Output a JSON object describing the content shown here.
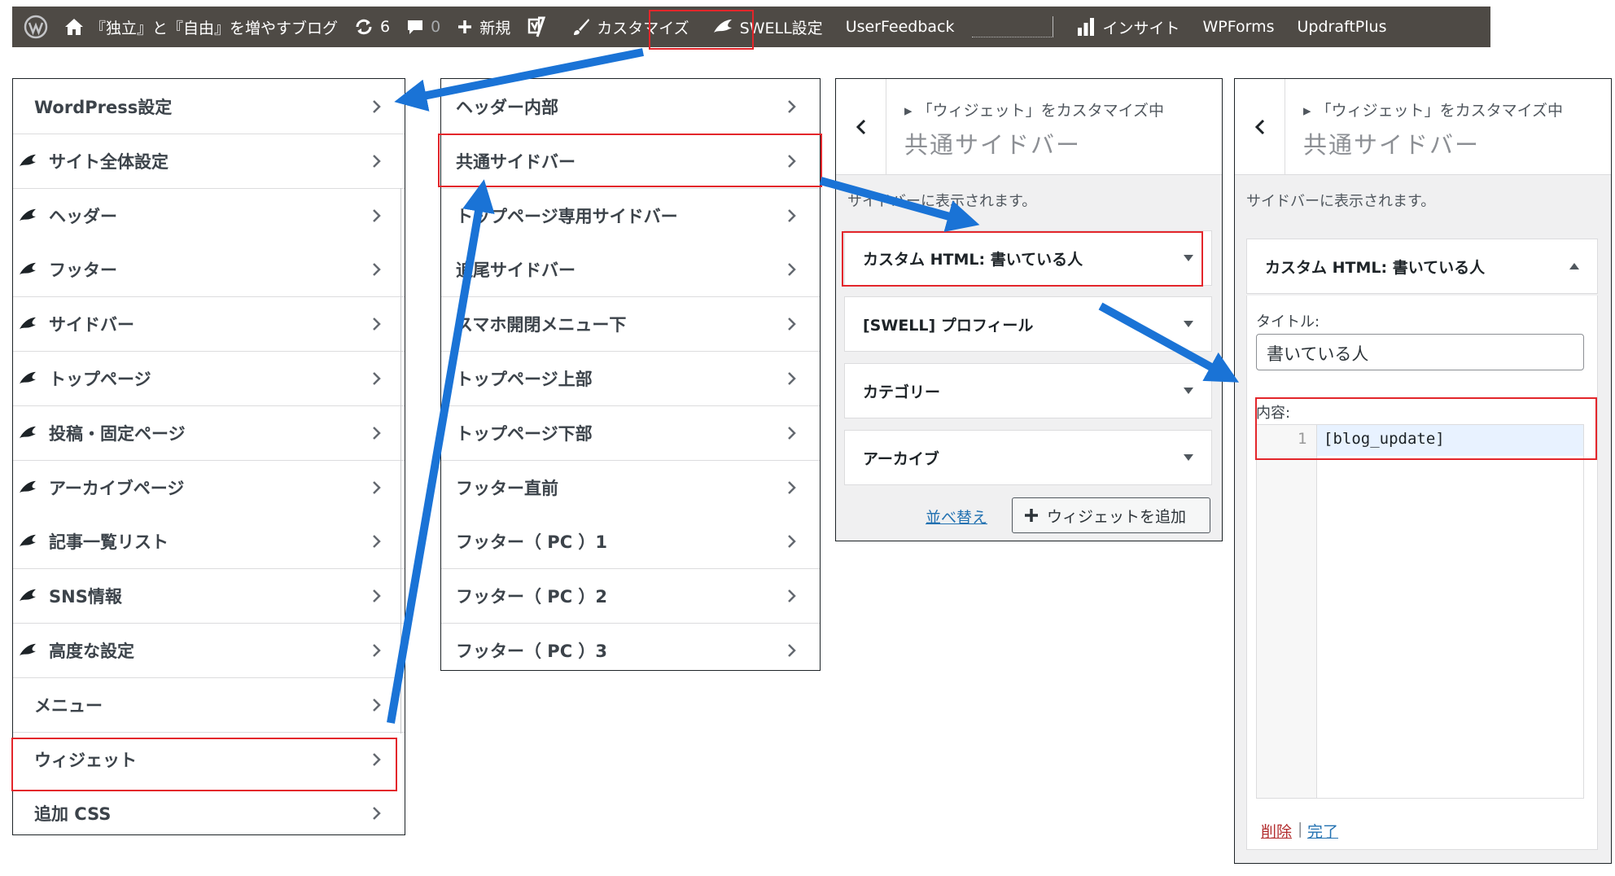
{
  "admin_bar": {
    "site_name": "『独立』と『自由』を増やすブログ",
    "updates_count": "6",
    "comments_count": "0",
    "new_label": "新規",
    "customize_label": "カスタマイズ",
    "swell_settings_label": "SWELL設定",
    "user_feedback_label": "UserFeedback",
    "insights_label": "インサイト",
    "wpforms_label": "WPForms",
    "updraftplus_label": "UpdraftPlus"
  },
  "customizer_menu": {
    "items": [
      {
        "label": "WordPress設定",
        "swell": false
      },
      {
        "label": "サイト全体設定",
        "swell": true
      },
      {
        "label": "ヘッダー",
        "swell": true
      },
      {
        "label": "フッター",
        "swell": true
      },
      {
        "label": "サイドバー",
        "swell": true
      },
      {
        "label": "トップページ",
        "swell": true
      },
      {
        "label": "投稿・固定ページ",
        "swell": true
      },
      {
        "label": "アーカイブページ",
        "swell": true
      },
      {
        "label": "記事一覧リスト",
        "swell": true
      },
      {
        "label": "SNS情報",
        "swell": true
      },
      {
        "label": "高度な設定",
        "swell": true
      },
      {
        "label": "メニュー",
        "swell": false
      },
      {
        "label": "ウィジェット",
        "swell": false
      },
      {
        "label": "追加 CSS",
        "swell": false
      }
    ]
  },
  "widget_areas": {
    "items": [
      "ヘッダー内部",
      "共通サイドバー",
      "トップページ専用サイドバー",
      "追尾サイドバー",
      "スマホ開閉メニュー下",
      "トップページ上部",
      "トップページ下部",
      "フッター直前",
      "フッター（ PC ）1",
      "フッター（ PC ）2",
      "フッター（ PC ）3"
    ]
  },
  "sidebar_section": {
    "breadcrumb": "「ウィジェット」をカスタマイズ中",
    "title": "共通サイドバー",
    "description": "サイドバーに表示されます。",
    "widgets": [
      "カスタム HTML: 書いている人",
      "[SWELL] プロフィール",
      "カテゴリー",
      "アーカイブ"
    ],
    "reorder_label": "並べ替え",
    "add_widget_label": "ウィジェットを追加"
  },
  "widget_detail": {
    "breadcrumb": "「ウィジェット」をカスタマイズ中",
    "title": "共通サイドバー",
    "description": "サイドバーに表示されます。",
    "widget_name": "カスタム HTML: 書いている人",
    "title_label": "タイトル:",
    "title_value": "書いている人",
    "content_label": "内容:",
    "line_number": "1",
    "code": "[blog_update]",
    "delete_label": "削除",
    "separator": "|",
    "done_label": "完了"
  },
  "colors": {
    "admin_bar_bg": "#4e4a45",
    "highlight_red": "#e3262b",
    "arrow_blue": "#1a73d6",
    "link_blue": "#2271b1",
    "delete_red": "#b32d2e"
  }
}
